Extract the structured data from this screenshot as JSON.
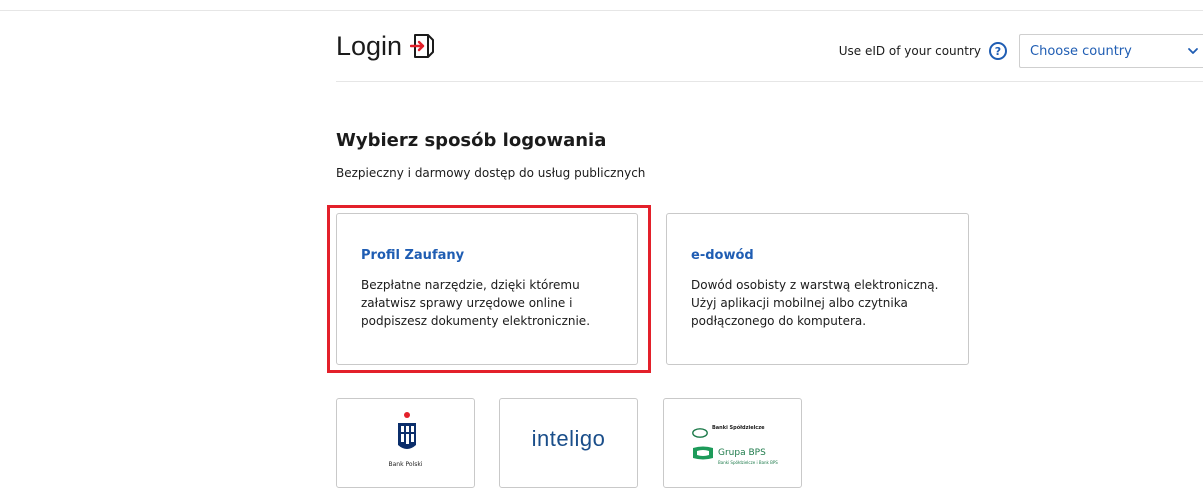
{
  "header": {
    "title": "Login",
    "eid_label": "Use eID of your country",
    "help_glyph": "?",
    "country_select": {
      "value": "Choose country"
    }
  },
  "section": {
    "heading": "Wybierz sposób logowania",
    "subheading": "Bezpieczny i darmowy dostęp do usług publicznych"
  },
  "methods": [
    {
      "title": "Profil Zaufany",
      "description": "Bezpłatne narzędzie, dzięki któremu załatwisz sprawy urzędowe online i podpiszesz dokumenty elektronicznie."
    },
    {
      "title": "e-dowód",
      "description": "Dowód osobisty z warstwą elektroniczną. Użyj aplikacji mobilnej albo czytnika podłączonego do komputera."
    }
  ],
  "banks": [
    {
      "name": "Bank Polski"
    },
    {
      "name": "inteligo"
    },
    {
      "tag": "Banki Spółdzielcze",
      "name": "Grupa BPS",
      "sub": "Banki Spółdzielcze i Bank BPS"
    }
  ],
  "colors": {
    "accent": "#1f5db3",
    "highlight": "#e3202a",
    "login_icon": "#e3202a"
  },
  "icons": {
    "login": "login-arrow-icon",
    "help": "help-icon",
    "dropdown": "chevron-down-icon",
    "pko": "pko-logo-icon",
    "sgb": "sgb-logo-icon",
    "bps": "bps-logo-icon"
  }
}
